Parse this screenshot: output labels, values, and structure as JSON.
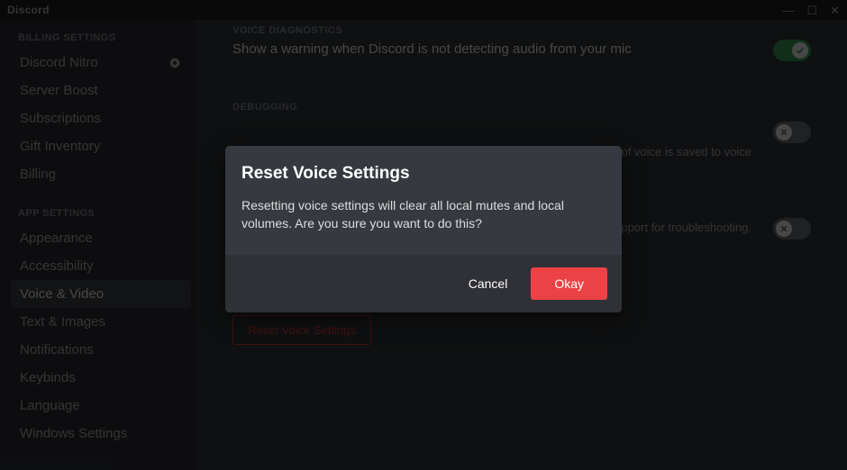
{
  "titlebar": {
    "brand": "Discord"
  },
  "sidebar": {
    "billing_header": "BILLING SETTINGS",
    "app_header": "APP SETTINGS",
    "items_billing": [
      {
        "label": "Discord Nitro",
        "has_badge": true
      },
      {
        "label": "Server Boost"
      },
      {
        "label": "Subscriptions"
      },
      {
        "label": "Gift Inventory"
      },
      {
        "label": "Billing"
      }
    ],
    "items_app": [
      {
        "label": "Appearance"
      },
      {
        "label": "Accessibility"
      },
      {
        "label": "Voice & Video",
        "active": true
      },
      {
        "label": "Text & Images"
      },
      {
        "label": "Notifications"
      },
      {
        "label": "Keybinds"
      },
      {
        "label": "Language"
      },
      {
        "label": "Windows Settings"
      }
    ]
  },
  "content": {
    "voice_diag_header": "VOICE DIAGNOSTICS",
    "voice_diag_title": "Show a warning when Discord is not detecting audio from your mic",
    "debugging_header": "DEBUGGING",
    "debug_row1_desc_fragment": "five minutes of voice is saved to voice",
    "debug_row2_desc_fragment": "pport for troubleshooting.",
    "reset_button": "Reset Voice Settings"
  },
  "modal": {
    "title": "Reset Voice Settings",
    "text": "Resetting voice settings will clear all local mutes and local volumes. Are you sure you want to do this?",
    "cancel": "Cancel",
    "ok": "Okay"
  }
}
